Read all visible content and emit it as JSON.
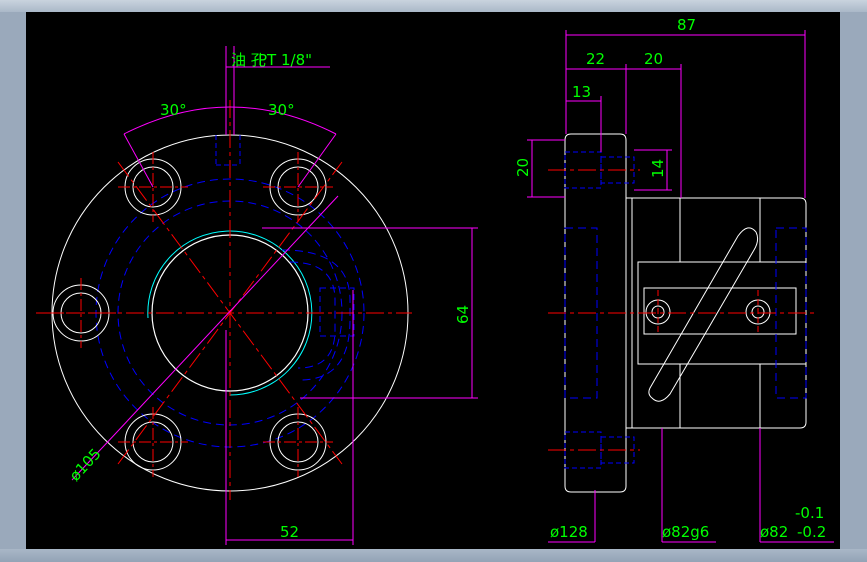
{
  "colors": {
    "background": "#000000",
    "outline": "#ffffff",
    "dimension": "#ff00ff",
    "dimension_text": "#00ff00",
    "centerline": "#ff0000",
    "hidden": "#0000ff",
    "thread": "#00ffff",
    "frame": "#9aa9bb"
  },
  "front_view": {
    "oil_hole_label": "油 孔",
    "oil_hole_spec": "PT 1/8\"",
    "angle_left": "30°",
    "angle_right": "30°",
    "height_dim": "64",
    "bolt_circle_dim": "ø105",
    "width_dim": "52"
  },
  "side_view": {
    "total_length": "87",
    "flange_thickness": "22",
    "offset_dim": "20",
    "counterbore_depth": "13",
    "counterbore_dia": "20",
    "hole_dia": "14",
    "flange_dia": "ø128",
    "body_dia": "ø82g6",
    "tol_dia": "ø82",
    "tol_upper": "-0.1",
    "tol_lower": "-0.2"
  }
}
